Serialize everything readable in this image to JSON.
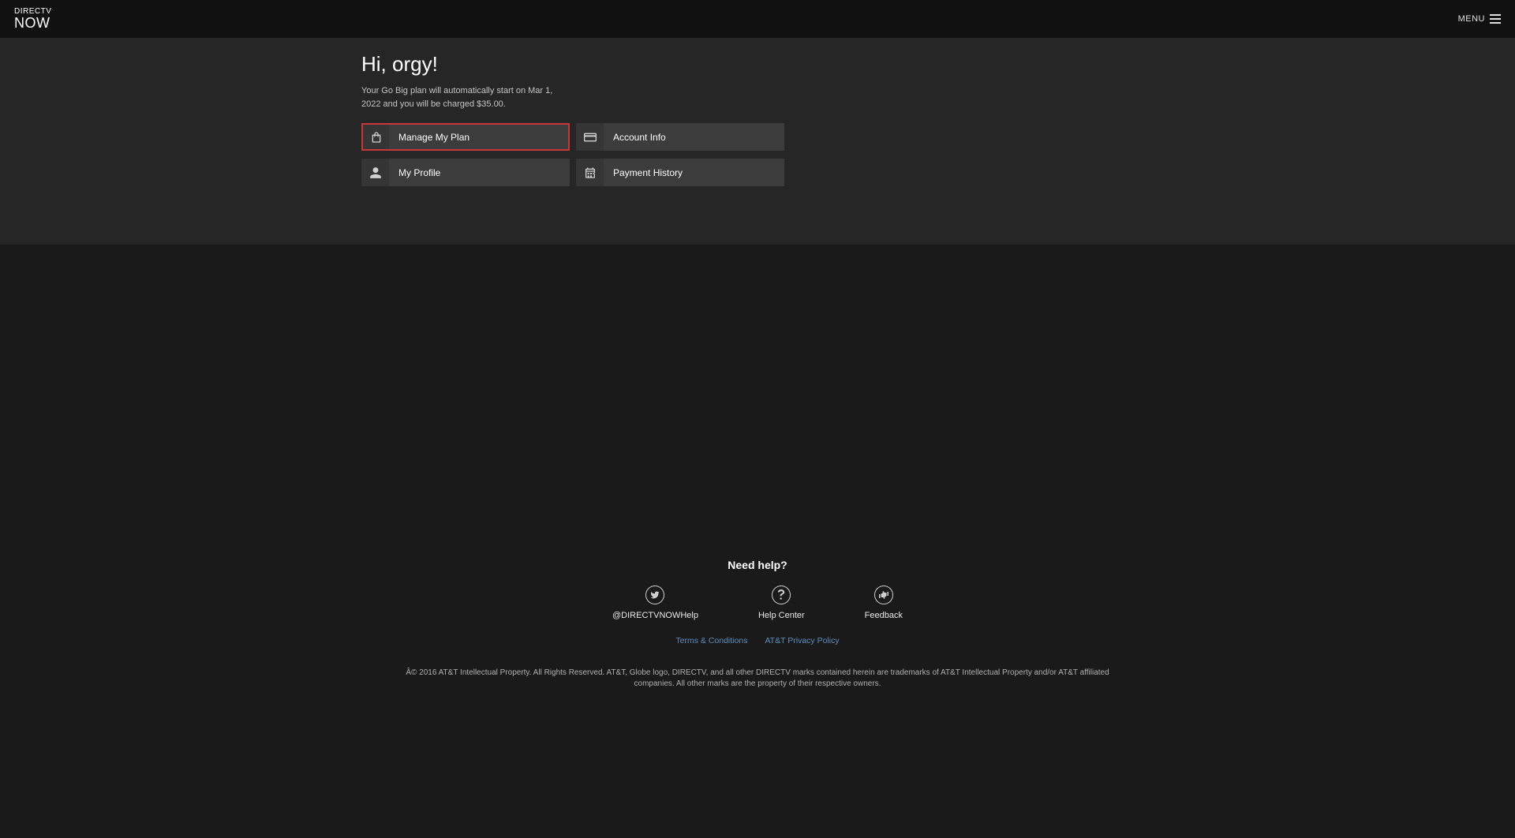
{
  "header": {
    "logo_top": "DIRECTV",
    "logo_bottom": "NOW",
    "menu_label": "MENU"
  },
  "main": {
    "greeting": "Hi, orgy!",
    "plan_description": "Your Go Big plan will automatically start on Mar 1, 2022 and you will be charged $35.00.",
    "tiles": {
      "manage_plan": "Manage My Plan",
      "account_info": "Account Info",
      "my_profile": "My Profile",
      "payment_history": "Payment History"
    }
  },
  "footer": {
    "need_help": "Need help?",
    "help_items": {
      "twitter": "@DIRECTVNOWHelp",
      "help_center": "Help Center",
      "feedback": "Feedback"
    },
    "links": {
      "terms": "Terms & Conditions",
      "privacy": "AT&T Privacy Policy"
    },
    "copyright": "Â© 2016 AT&T Intellectual Property. All Rights Reserved. AT&T, Globe logo, DIRECTV, and all other DIRECTV marks contained herein are trademarks of AT&T Intellectual Property and/or AT&T affiliated companies. All other marks are the property of their respective owners."
  }
}
